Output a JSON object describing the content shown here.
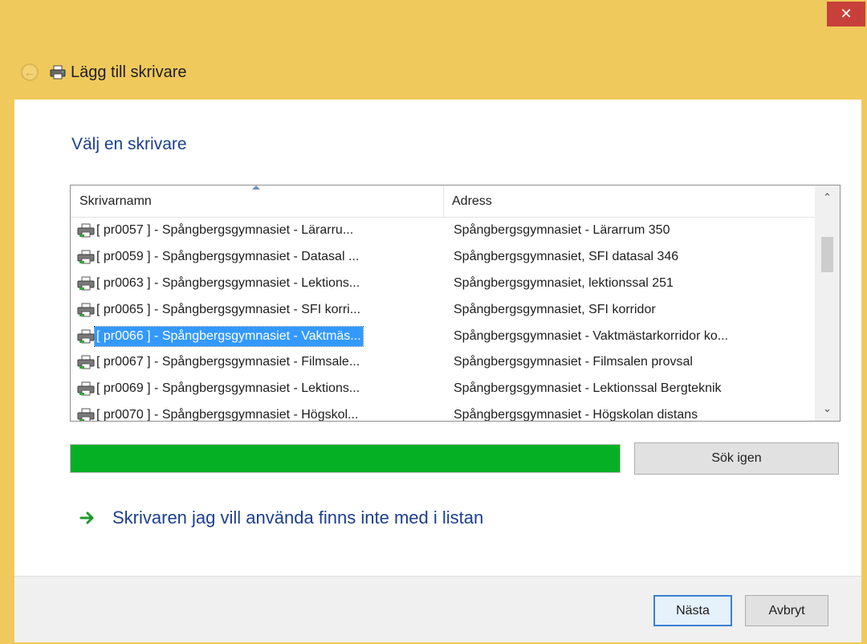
{
  "window": {
    "title": "Lägg till skrivare",
    "close_label": "✕"
  },
  "main": {
    "heading": "Välj en skrivare",
    "columns": {
      "name": "Skrivarnamn",
      "address": "Adress"
    },
    "rows": [
      {
        "name": "[ pr0057 ] - Spångbergsgymnasiet - Lärarru...",
        "address": "Spångbergsgymnasiet - Lärarrum 350"
      },
      {
        "name": "[ pr0059 ] - Spångbergsgymnasiet - Datasal ...",
        "address": "Spångbergsgymnasiet, SFI datasal 346"
      },
      {
        "name": "[ pr0063 ] - Spångbergsgymnasiet - Lektions...",
        "address": "Spångbergsgymnasiet, lektionssal 251"
      },
      {
        "name": "[ pr0065 ] - Spångbergsgymnasiet - SFI korri...",
        "address": "Spångbergsgymnasiet, SFI korridor"
      },
      {
        "name": "[ pr0066 ] - Spångbergsgymnasiet - Vaktmäs...",
        "address": "Spångbergsgymnasiet - Vaktmästarkorridor ko...",
        "selected": true
      },
      {
        "name": "[ pr0067 ] - Spångbergsgymnasiet - Filmsale...",
        "address": "Spångbergsgymnasiet - Filmsalen provsal"
      },
      {
        "name": "[ pr0069 ] - Spångbergsgymnasiet - Lektions...",
        "address": "Spångbergsgymnasiet - Lektionssal Bergteknik"
      },
      {
        "name": "[ pr0070 ] - Spångbergsgymnasiet - Högskol...",
        "address": "Spångbergsgymnasiet - Högskolan distans"
      }
    ],
    "progress": 1.0,
    "search_again_label": "Sök igen",
    "missing_printer_link": "Skrivaren jag vill använda finns inte med i listan"
  },
  "footer": {
    "next_label": "Nästa",
    "cancel_label": "Avbryt"
  },
  "colors": {
    "titlebar": "#f0c95c",
    "close": "#c7413a",
    "heading": "#1b3f8f",
    "selection": "#3399ff",
    "progress": "#06b025"
  },
  "icons": {
    "back": "back-arrow-icon",
    "printer": "printer-icon",
    "link_arrow": "green-arrow-icon"
  }
}
